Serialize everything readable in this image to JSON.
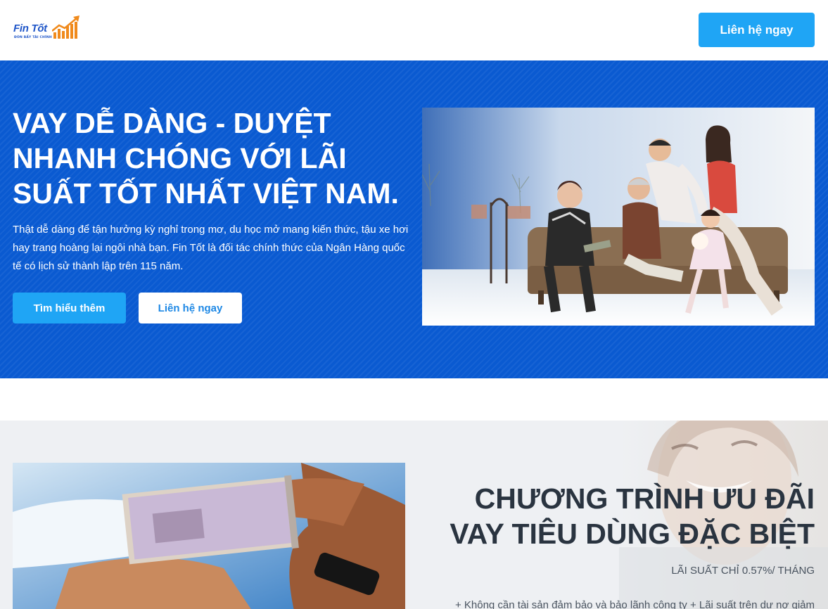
{
  "header": {
    "logo_text": "Fin Tốt",
    "logo_tagline": "ĐÒN BẨY TÀI CHÍNH",
    "cta_label": "Liên hệ ngay"
  },
  "hero": {
    "title": "VAY DỄ DÀNG - DUYỆT NHANH CHÓNG VỚI LÃI SUẤT TỐT NHẤT VIỆT NAM.",
    "description": "Thật dễ dàng để tận hưởng kỳ nghỉ trong mơ, du học mở mang kiến thức, tậu xe hơi hay trang hoàng lại ngôi nhà bạn. Fin Tốt là đối tác chính thức của Ngân Hàng quốc tế có lịch sử thành lập trên 115 năm.",
    "btn_learn_more": "Tìm hiểu thêm",
    "btn_contact": "Liên hệ ngay",
    "bg_color": "#0a5ad1"
  },
  "promo": {
    "title": "CHƯƠNG TRÌNH ƯU ĐÃI VAY TIÊU DÙNG ĐẶC BIỆT",
    "subtitle": "LÃI SUẤT CHỈ 0.57%/ THÁNG",
    "body": "+ Không cần tài sản đảm bảo và bảo lãnh công ty + Lãi suất trên dư nợ giảm"
  },
  "colors": {
    "accent": "#1fa5f5",
    "brand_blue": "#1e55c8",
    "logo_orange": "#f08a1c"
  }
}
